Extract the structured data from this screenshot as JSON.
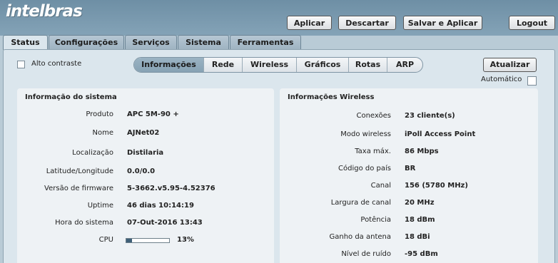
{
  "header": {
    "logo": "intelbras",
    "buttons": {
      "aplicar": "Aplicar",
      "descartar": "Descartar",
      "salvar_aplicar": "Salvar e Aplicar",
      "logout": "Logout"
    }
  },
  "tabs": [
    "Status",
    "Configurações",
    "Serviços",
    "Sistema",
    "Ferramentas"
  ],
  "toolbar": {
    "alto_contraste": "Alto contraste",
    "subtabs": [
      "Informações",
      "Rede",
      "Wireless",
      "Gráficos",
      "Rotas",
      "ARP"
    ],
    "atualizar": "Atualizar",
    "automatico": "Automático"
  },
  "sistema": {
    "title": "Informação do sistema",
    "rows": [
      {
        "label": "Produto",
        "value": "APC 5M-90 +"
      },
      {
        "label": "Nome",
        "value": "AJNet02"
      },
      {
        "label": "Localização",
        "value": "Distilaria"
      },
      {
        "label": "Latitude/Longitude",
        "value": "0.0/0.0"
      },
      {
        "label": "Versão de firmware",
        "value": "5-3662.v5.95-4.52376"
      },
      {
        "label": "Uptime",
        "value": "46 dias 10:14:19"
      },
      {
        "label": "Hora do sistema",
        "value": "07-Out-2016 13:43"
      }
    ],
    "cpu": {
      "label": "CPU",
      "value": "13%",
      "fraction": 0.13
    }
  },
  "wireless": {
    "title": "Informações Wireless",
    "rows": [
      {
        "label": "Conexões",
        "value": "23 cliente(s)"
      },
      {
        "label": "Modo wireless",
        "value": "iPoll Access Point"
      },
      {
        "label": "Taxa máx.",
        "value": "86 Mbps"
      },
      {
        "label": "Código do país",
        "value": "BR"
      },
      {
        "label": "Canal",
        "value": "156 (5780 MHz)"
      },
      {
        "label": "Largura de canal",
        "value": "20 MHz"
      },
      {
        "label": "Potência",
        "value": "18 dBm"
      },
      {
        "label": "Ganho da antena",
        "value": "18 dBi"
      },
      {
        "label": "Nível de ruído",
        "value": "-95 dBm"
      }
    ]
  }
}
